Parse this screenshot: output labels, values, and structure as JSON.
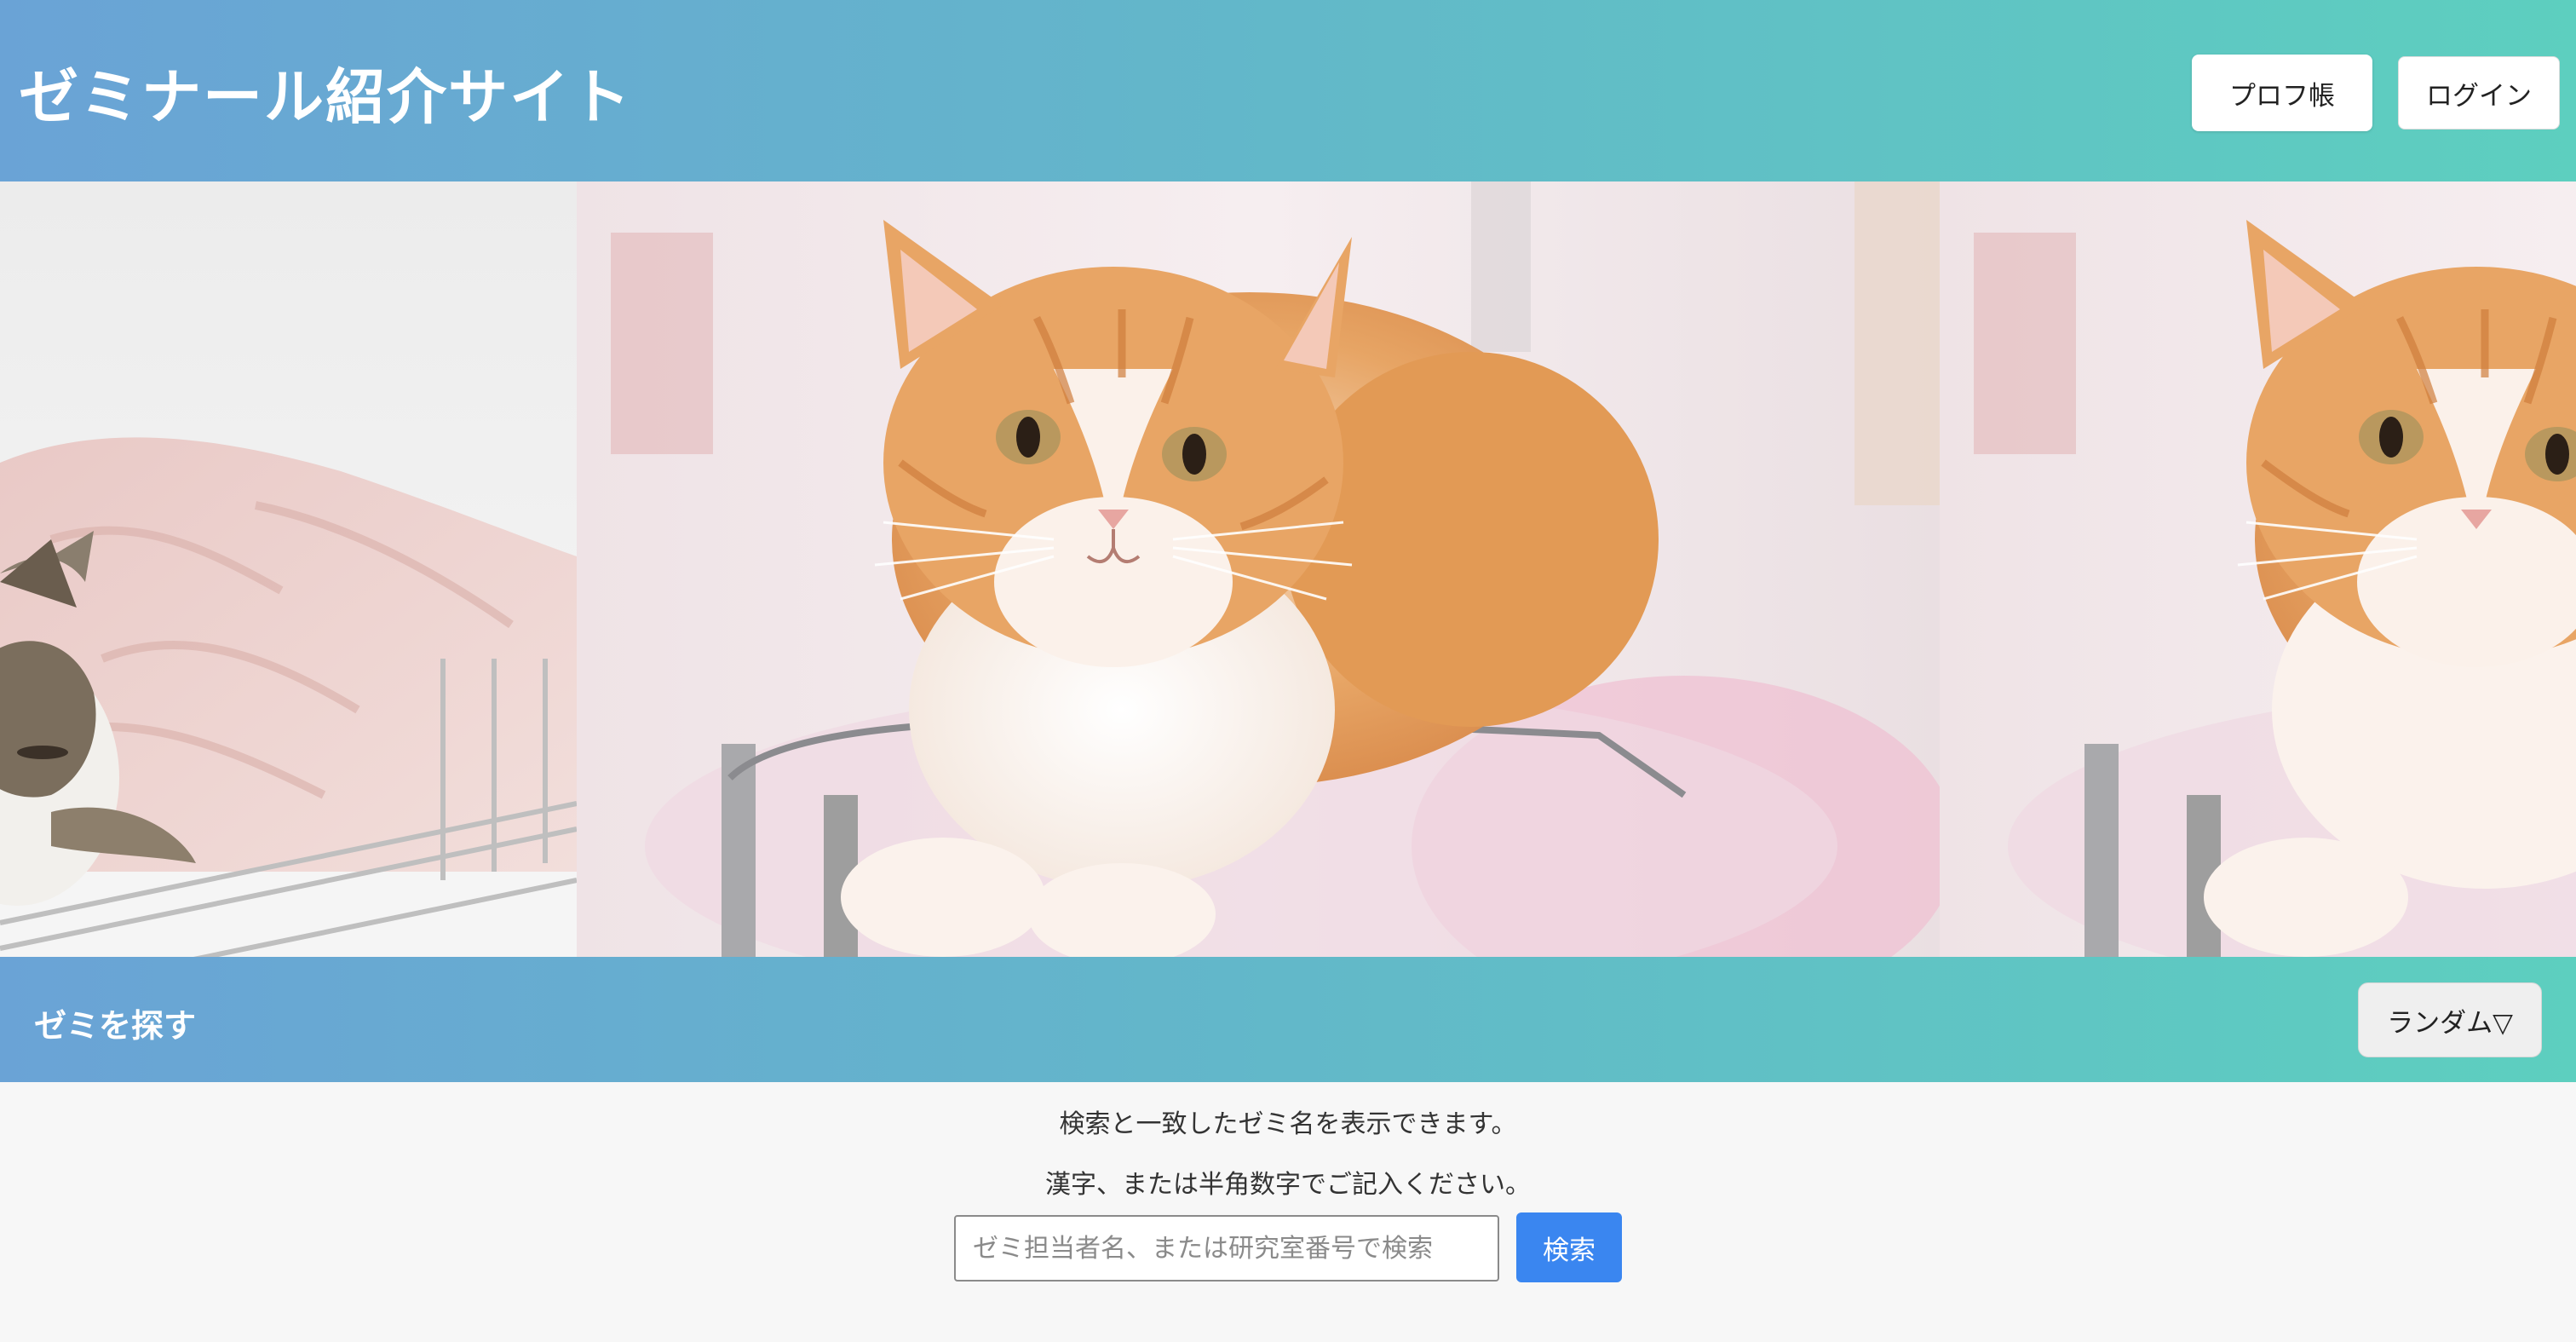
{
  "header": {
    "title": "ゼミナール紹介サイト",
    "prof_button": "プロフ帳",
    "login_button": "ログイン"
  },
  "carousel": {
    "slides": [
      {
        "subject": "sleeping tabby kitten on pink blanket"
      },
      {
        "subject": "orange and white long-haired cat on glass stool"
      },
      {
        "subject": "orange and white long-haired cat on glass stool"
      }
    ]
  },
  "search_bar": {
    "title": "ゼミを探す",
    "sort_button": "ランダム▽"
  },
  "search": {
    "info_1": "検索と一致したゼミ名を表示できます。",
    "info_2": "漢字、または半角数字でご記入ください。",
    "placeholder": "ゼミ担当者名、または研究室番号で検索",
    "button": "検索"
  },
  "colors": {
    "gradient_start": "#6aa3d6",
    "gradient_end": "#5dcfbf",
    "search_button": "#3a86f0"
  }
}
